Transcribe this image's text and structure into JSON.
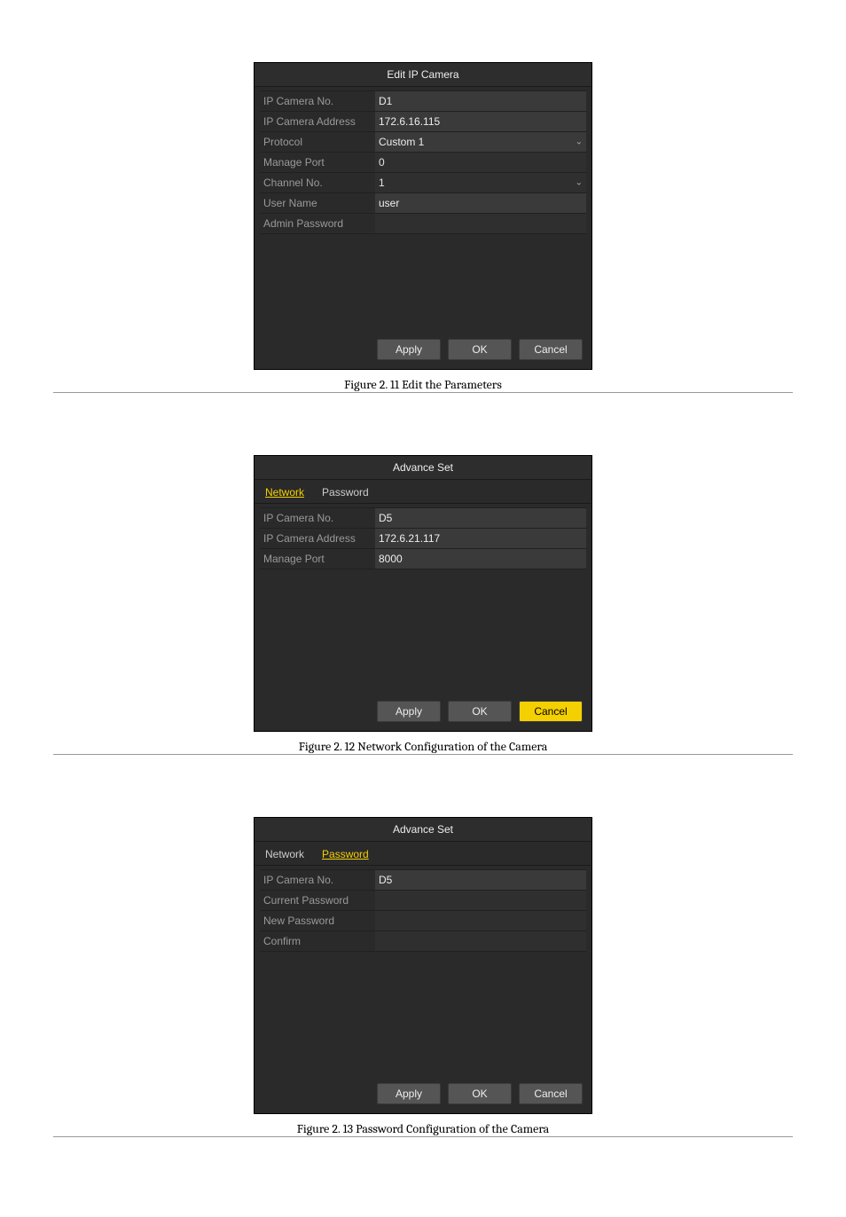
{
  "fig1": {
    "dialog_title": "Edit IP Camera",
    "rows": [
      {
        "label": "IP Camera No.",
        "value": "D1",
        "mode": "input"
      },
      {
        "label": "IP Camera Address",
        "value": "172.6.16.115",
        "mode": "input"
      },
      {
        "label": "Protocol",
        "value": "Custom 1",
        "mode": "dropdown"
      },
      {
        "label": "Manage Port",
        "value": "0",
        "mode": "plain"
      },
      {
        "label": "Channel No.",
        "value": "1",
        "mode": "dropdown-plain"
      },
      {
        "label": "User Name",
        "value": "user",
        "mode": "input"
      },
      {
        "label": "Admin Password",
        "value": "",
        "mode": "plain"
      }
    ],
    "buttons": {
      "apply": "Apply",
      "ok": "OK",
      "cancel": "Cancel"
    },
    "caption": "Figure 2. 11  Edit the Parameters"
  },
  "fig2": {
    "dialog_title": "Advance Set",
    "tabs": {
      "network": "Network",
      "password": "Password",
      "active": "network"
    },
    "rows": [
      {
        "label": "IP Camera No.",
        "value": "D5",
        "mode": "input"
      },
      {
        "label": "IP Camera Address",
        "value": "172.6.21.117",
        "mode": "input"
      },
      {
        "label": "Manage Port",
        "value": "8000",
        "mode": "input"
      }
    ],
    "buttons": {
      "apply": "Apply",
      "ok": "OK",
      "cancel": "Cancel",
      "highlight": "cancel"
    },
    "caption": "Figure 2. 12  Network Configuration of the Camera"
  },
  "fig3": {
    "dialog_title": "Advance Set",
    "tabs": {
      "network": "Network",
      "password": "Password",
      "active": "password"
    },
    "rows": [
      {
        "label": "IP Camera No.",
        "value": "D5",
        "mode": "input"
      },
      {
        "label": "Current Password",
        "value": "",
        "mode": "plain"
      },
      {
        "label": "New Password",
        "value": "",
        "mode": "plain"
      },
      {
        "label": "Confirm",
        "value": "",
        "mode": "plain"
      }
    ],
    "buttons": {
      "apply": "Apply",
      "ok": "OK",
      "cancel": "Cancel"
    },
    "caption": "Figure 2. 13  Password Configuration of the Camera"
  }
}
